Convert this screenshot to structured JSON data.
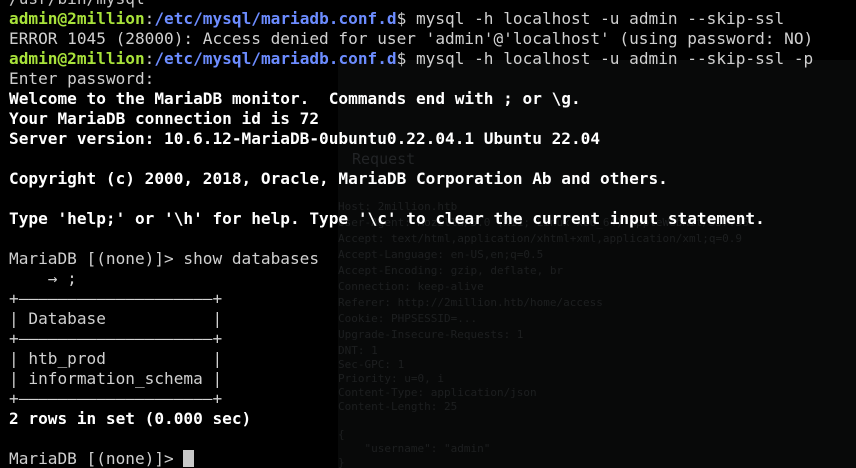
{
  "window": {
    "title": "Terminal",
    "background": "#000000",
    "user_color": "#a8e23a",
    "path_color": "#6c8cff"
  },
  "background_ghost": {
    "request_label": "Request",
    "lines": [
      "Host: 2million.htb",
      "User-Agent: Mozilla/5.0 (X11; Linux x86_64) AppleWebKit/537.36",
      "Accept: text/html,application/xhtml+xml,application/xml;q=0.9",
      "Accept-Language: en-US,en;q=0.5",
      "Accept-Encoding: gzip, deflate, br",
      "Connection: keep-alive",
      "Referer: http://2million.htb/home/access",
      "Cookie: PHPSESSID=...",
      "Upgrade-Insecure-Requests: 1",
      "DNT: 1",
      "Sec-GPC: 1",
      "Priority: u=0, i",
      "Content-Type: application/json",
      "Content-Length: 25",
      "",
      "{",
      "    \"username\": \"admin\"",
      "}"
    ]
  },
  "terminal": {
    "line0": "/usr/bin/mysql",
    "prompt1": {
      "user": "admin@2million",
      "sep": ":",
      "path": "/etc/mysql/mariadb.conf.d",
      "symbol": "$",
      "command": " mysql -h localhost -u admin --skip-ssl"
    },
    "error_line": "ERROR 1045 (28000): Access denied for user 'admin'@'localhost' (using password: NO)",
    "prompt2": {
      "user": "admin@2million",
      "sep": ":",
      "path": "/etc/mysql/mariadb.conf.d",
      "symbol": "$",
      "command": " mysql -h localhost -u admin --skip-ssl -p"
    },
    "enter_password": "Enter password: ",
    "welcome": "Welcome to the MariaDB monitor.  Commands end with ; or \\g.",
    "connection_id": "Your MariaDB connection id is 72",
    "server_version": "Server version: 10.6.12-MariaDB-0ubuntu0.22.04.1 Ubuntu 22.04",
    "copyright": "Copyright (c) 2000, 2018, Oracle, MariaDB Corporation Ab and others.",
    "help_line": "Type 'help;' or '\\h' for help. Type '\\c' to clear the current input statement.",
    "mariadb_prompt_cmd": "MariaDB [(none)]> show databases",
    "continuation": "    → ;",
    "table_border": "+————————————————————+",
    "table_header": "| Database           |",
    "table_rows": [
      "| htb_prod           |",
      "| information_schema |"
    ],
    "rows_summary": "2 rows in set (0.000 sec)",
    "final_prompt": "MariaDB [(none)]> "
  }
}
